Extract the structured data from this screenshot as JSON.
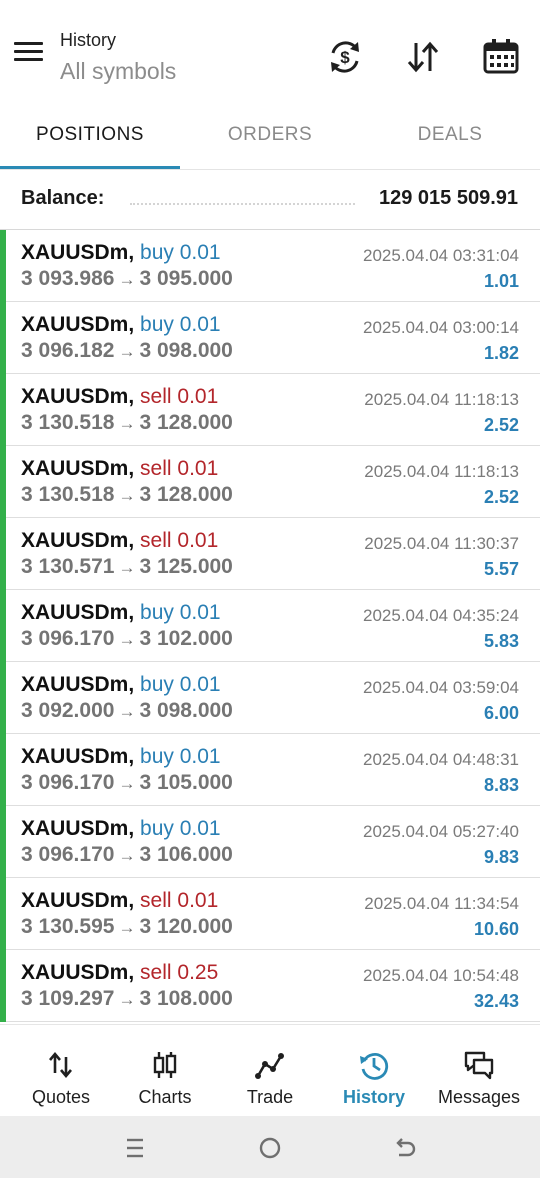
{
  "header": {
    "title": "History",
    "subtitle": "All symbols",
    "icons": [
      "menu-icon",
      "currency-exchange-icon",
      "sort-icon",
      "calendar-icon"
    ]
  },
  "tabs": [
    {
      "label": "POSITIONS",
      "active": true
    },
    {
      "label": "ORDERS",
      "active": false
    },
    {
      "label": "DEALS",
      "active": false
    }
  ],
  "balance": {
    "label": "Balance:",
    "value": "129 015 509.91"
  },
  "rows": [
    {
      "symbol": "XAUUSDm",
      "side": "buy",
      "volume": "0.01",
      "open": "3 093.986",
      "close": "3 095.000",
      "time": "2025.04.04 03:31:04",
      "profit": "1.01"
    },
    {
      "symbol": "XAUUSDm",
      "side": "buy",
      "volume": "0.01",
      "open": "3 096.182",
      "close": "3 098.000",
      "time": "2025.04.04 03:00:14",
      "profit": "1.82"
    },
    {
      "symbol": "XAUUSDm",
      "side": "sell",
      "volume": "0.01",
      "open": "3 130.518",
      "close": "3 128.000",
      "time": "2025.04.04 11:18:13",
      "profit": "2.52"
    },
    {
      "symbol": "XAUUSDm",
      "side": "sell",
      "volume": "0.01",
      "open": "3 130.518",
      "close": "3 128.000",
      "time": "2025.04.04 11:18:13",
      "profit": "2.52"
    },
    {
      "symbol": "XAUUSDm",
      "side": "sell",
      "volume": "0.01",
      "open": "3 130.571",
      "close": "3 125.000",
      "time": "2025.04.04 11:30:37",
      "profit": "5.57"
    },
    {
      "symbol": "XAUUSDm",
      "side": "buy",
      "volume": "0.01",
      "open": "3 096.170",
      "close": "3 102.000",
      "time": "2025.04.04 04:35:24",
      "profit": "5.83"
    },
    {
      "symbol": "XAUUSDm",
      "side": "buy",
      "volume": "0.01",
      "open": "3 092.000",
      "close": "3 098.000",
      "time": "2025.04.04 03:59:04",
      "profit": "6.00"
    },
    {
      "symbol": "XAUUSDm",
      "side": "buy",
      "volume": "0.01",
      "open": "3 096.170",
      "close": "3 105.000",
      "time": "2025.04.04 04:48:31",
      "profit": "8.83"
    },
    {
      "symbol": "XAUUSDm",
      "side": "buy",
      "volume": "0.01",
      "open": "3 096.170",
      "close": "3 106.000",
      "time": "2025.04.04 05:27:40",
      "profit": "9.83"
    },
    {
      "symbol": "XAUUSDm",
      "side": "sell",
      "volume": "0.01",
      "open": "3 130.595",
      "close": "3 120.000",
      "time": "2025.04.04 11:34:54",
      "profit": "10.60"
    },
    {
      "symbol": "XAUUSDm",
      "side": "sell",
      "volume": "0.25",
      "open": "3 109.297",
      "close": "3 108.000",
      "time": "2025.04.04 10:54:48",
      "profit": "32.43"
    }
  ],
  "bottom_nav": [
    {
      "label": "Quotes",
      "icon": "quotes-arrows-icon",
      "active": false
    },
    {
      "label": "Charts",
      "icon": "candlestick-icon",
      "active": false
    },
    {
      "label": "Trade",
      "icon": "trade-line-icon",
      "active": false
    },
    {
      "label": "History",
      "icon": "history-icon",
      "active": true
    },
    {
      "label": "Messages",
      "icon": "messages-icon",
      "active": false
    }
  ],
  "system_bar": [
    "recents-icon",
    "home-icon",
    "back-icon"
  ],
  "colors": {
    "accent": "#2a8ab5",
    "buy": "#2a7fb4",
    "sell": "#b3262b",
    "profit_bar": "#33b04a",
    "muted": "#8a8a8a"
  }
}
